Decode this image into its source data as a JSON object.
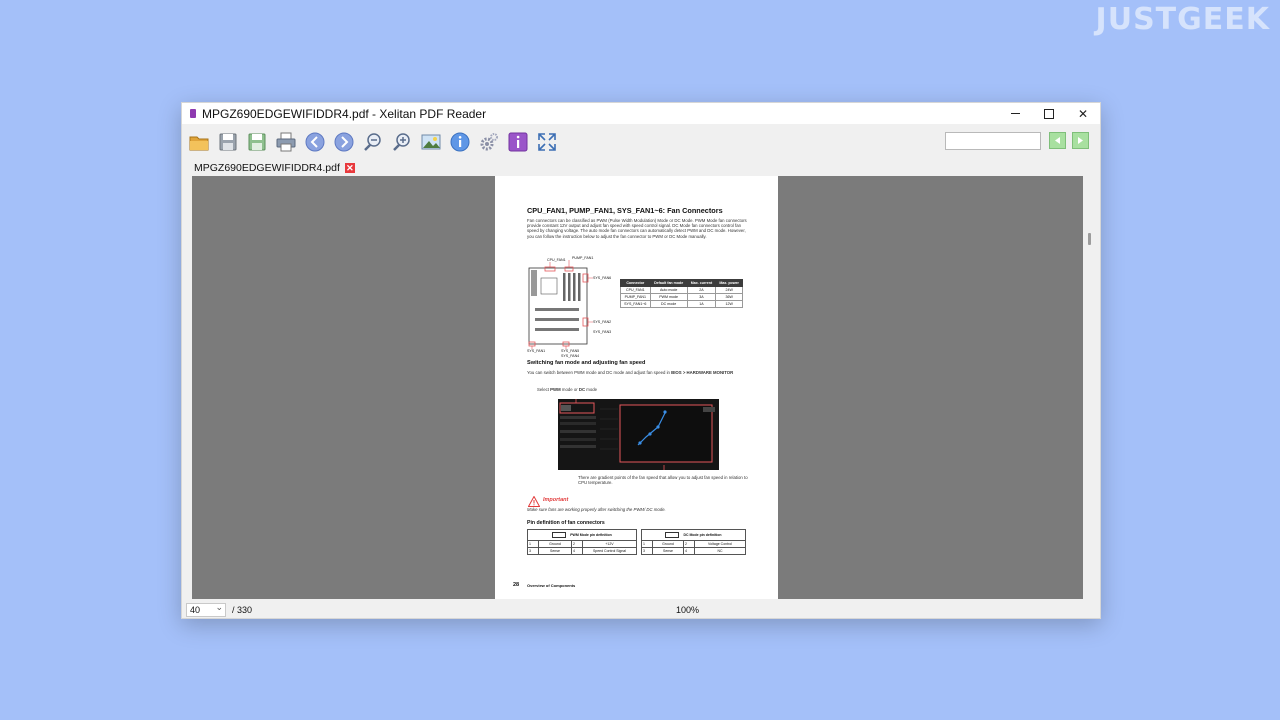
{
  "watermark": "JUSTGEEK",
  "window": {
    "title": "MPGZ690EDGEWIFIDDR4.pdf - Xelitan PDF Reader",
    "controls": {
      "close": "✕"
    }
  },
  "toolbar": {
    "icons": [
      "open-folder-icon",
      "save-icon",
      "save-as-icon",
      "print-icon",
      "previous-page-icon",
      "next-page-icon",
      "zoom-out-icon",
      "zoom-in-icon",
      "image-icon",
      "info-icon",
      "settings-icon",
      "about-icon",
      "fit-icon"
    ],
    "search_value": "",
    "prev_label": "◀",
    "next_label": "▶",
    "accent_color": "#8aa2df"
  },
  "tab": {
    "label": "MPGZ690EDGEWIFIDDR4.pdf",
    "close": "✕"
  },
  "status": {
    "current_page": "40",
    "total": "/ 330",
    "zoom": "100%"
  },
  "document": {
    "heading": "CPU_FAN1, PUMP_FAN1, SYS_FAN1~6: Fan Connectors",
    "intro": "Fan connectors can be classified as PWM (Pulse Width Modulation) Mode or DC Mode. PWM Mode fan connectors provide constant 12V output and adjust fan speed with speed control signal. DC Mode fan connectors control fan speed by changing voltage. The auto mode fan connectors can automatically detect PWM and DC mode. However, you can follow the instruction below to adjust the fan connector to PWM or DC Mode manually.",
    "board_labels": [
      "CPU_FAN1",
      "PUMP_FAN1",
      "SYS_FAN6",
      "SYS_FAN2",
      "SYS_FAN3",
      "SYS_FAN1",
      "SYS_FAN5",
      "SYS_FAN4"
    ],
    "fan_table": {
      "headers": [
        "Connector",
        "Default fan mode",
        "Max. current",
        "Max. power"
      ],
      "rows": [
        [
          "CPU_FAN1",
          "Auto mode",
          "2A",
          "24W"
        ],
        [
          "PUMP_FAN1",
          "PWM mode",
          "3A",
          "36W"
        ],
        [
          "SYS_FAN1~6",
          "DC mode",
          "1A",
          "12W"
        ]
      ]
    },
    "subheading": "Switching fan mode and adjusting fan speed",
    "switch_text": "You can switch between PWM mode and DC mode and adjust fan speed in",
    "switch_bold": "BIOS > HARDWARE MONITOR",
    "select_prefix": "Select",
    "select_pwm": "PWM",
    "select_mid": "mode or",
    "select_dc": "DC",
    "select_suffix": "mode",
    "gradient_note": "There are gradient points of the fan speed that allow you to adjust fan speed in relation to CPU temperature.",
    "important_title": "Important",
    "important_text": "Make sure fans are working properly after switching the PWM/ DC mode.",
    "pin_heading": "Pin definition of fan connectors",
    "pwm_pin_title": "PWM Mode pin definition",
    "pwm_pins": [
      [
        "1",
        "Ground",
        "2",
        "+12V"
      ],
      [
        "3",
        "Sense",
        "4",
        "Speed Control Signal"
      ]
    ],
    "dc_pin_title": "DC Mode pin definition",
    "dc_pins": [
      [
        "1",
        "Ground",
        "2",
        "Voltage Control"
      ],
      [
        "3",
        "Sense",
        "4",
        "NC"
      ]
    ],
    "page_number": "28",
    "footer": "Overview of Components"
  }
}
